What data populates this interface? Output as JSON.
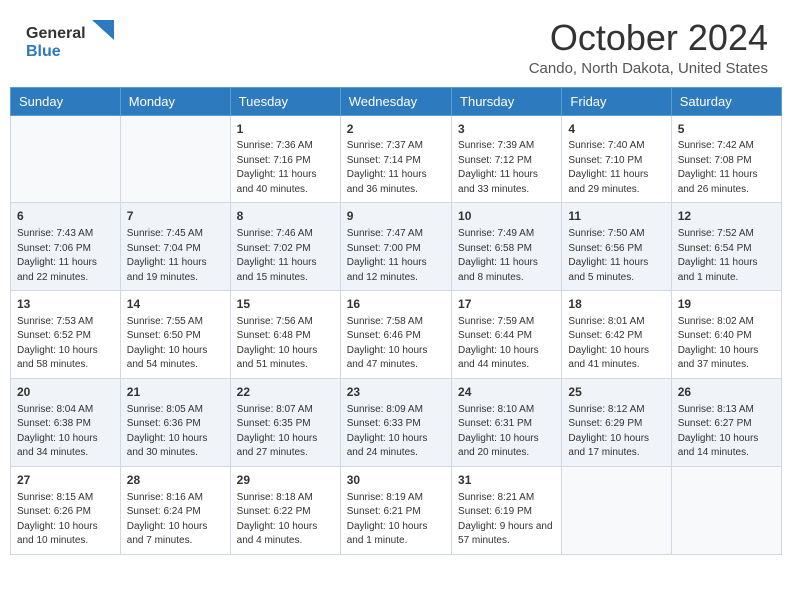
{
  "header": {
    "logo_line1": "General",
    "logo_line2": "Blue",
    "month": "October 2024",
    "location": "Cando, North Dakota, United States"
  },
  "days_of_week": [
    "Sunday",
    "Monday",
    "Tuesday",
    "Wednesday",
    "Thursday",
    "Friday",
    "Saturday"
  ],
  "weeks": [
    [
      {
        "day": "",
        "sunrise": "",
        "sunset": "",
        "daylight": ""
      },
      {
        "day": "",
        "sunrise": "",
        "sunset": "",
        "daylight": ""
      },
      {
        "day": "1",
        "sunrise": "Sunrise: 7:36 AM",
        "sunset": "Sunset: 7:16 PM",
        "daylight": "Daylight: 11 hours and 40 minutes."
      },
      {
        "day": "2",
        "sunrise": "Sunrise: 7:37 AM",
        "sunset": "Sunset: 7:14 PM",
        "daylight": "Daylight: 11 hours and 36 minutes."
      },
      {
        "day": "3",
        "sunrise": "Sunrise: 7:39 AM",
        "sunset": "Sunset: 7:12 PM",
        "daylight": "Daylight: 11 hours and 33 minutes."
      },
      {
        "day": "4",
        "sunrise": "Sunrise: 7:40 AM",
        "sunset": "Sunset: 7:10 PM",
        "daylight": "Daylight: 11 hours and 29 minutes."
      },
      {
        "day": "5",
        "sunrise": "Sunrise: 7:42 AM",
        "sunset": "Sunset: 7:08 PM",
        "daylight": "Daylight: 11 hours and 26 minutes."
      }
    ],
    [
      {
        "day": "6",
        "sunrise": "Sunrise: 7:43 AM",
        "sunset": "Sunset: 7:06 PM",
        "daylight": "Daylight: 11 hours and 22 minutes."
      },
      {
        "day": "7",
        "sunrise": "Sunrise: 7:45 AM",
        "sunset": "Sunset: 7:04 PM",
        "daylight": "Daylight: 11 hours and 19 minutes."
      },
      {
        "day": "8",
        "sunrise": "Sunrise: 7:46 AM",
        "sunset": "Sunset: 7:02 PM",
        "daylight": "Daylight: 11 hours and 15 minutes."
      },
      {
        "day": "9",
        "sunrise": "Sunrise: 7:47 AM",
        "sunset": "Sunset: 7:00 PM",
        "daylight": "Daylight: 11 hours and 12 minutes."
      },
      {
        "day": "10",
        "sunrise": "Sunrise: 7:49 AM",
        "sunset": "Sunset: 6:58 PM",
        "daylight": "Daylight: 11 hours and 8 minutes."
      },
      {
        "day": "11",
        "sunrise": "Sunrise: 7:50 AM",
        "sunset": "Sunset: 6:56 PM",
        "daylight": "Daylight: 11 hours and 5 minutes."
      },
      {
        "day": "12",
        "sunrise": "Sunrise: 7:52 AM",
        "sunset": "Sunset: 6:54 PM",
        "daylight": "Daylight: 11 hours and 1 minute."
      }
    ],
    [
      {
        "day": "13",
        "sunrise": "Sunrise: 7:53 AM",
        "sunset": "Sunset: 6:52 PM",
        "daylight": "Daylight: 10 hours and 58 minutes."
      },
      {
        "day": "14",
        "sunrise": "Sunrise: 7:55 AM",
        "sunset": "Sunset: 6:50 PM",
        "daylight": "Daylight: 10 hours and 54 minutes."
      },
      {
        "day": "15",
        "sunrise": "Sunrise: 7:56 AM",
        "sunset": "Sunset: 6:48 PM",
        "daylight": "Daylight: 10 hours and 51 minutes."
      },
      {
        "day": "16",
        "sunrise": "Sunrise: 7:58 AM",
        "sunset": "Sunset: 6:46 PM",
        "daylight": "Daylight: 10 hours and 47 minutes."
      },
      {
        "day": "17",
        "sunrise": "Sunrise: 7:59 AM",
        "sunset": "Sunset: 6:44 PM",
        "daylight": "Daylight: 10 hours and 44 minutes."
      },
      {
        "day": "18",
        "sunrise": "Sunrise: 8:01 AM",
        "sunset": "Sunset: 6:42 PM",
        "daylight": "Daylight: 10 hours and 41 minutes."
      },
      {
        "day": "19",
        "sunrise": "Sunrise: 8:02 AM",
        "sunset": "Sunset: 6:40 PM",
        "daylight": "Daylight: 10 hours and 37 minutes."
      }
    ],
    [
      {
        "day": "20",
        "sunrise": "Sunrise: 8:04 AM",
        "sunset": "Sunset: 6:38 PM",
        "daylight": "Daylight: 10 hours and 34 minutes."
      },
      {
        "day": "21",
        "sunrise": "Sunrise: 8:05 AM",
        "sunset": "Sunset: 6:36 PM",
        "daylight": "Daylight: 10 hours and 30 minutes."
      },
      {
        "day": "22",
        "sunrise": "Sunrise: 8:07 AM",
        "sunset": "Sunset: 6:35 PM",
        "daylight": "Daylight: 10 hours and 27 minutes."
      },
      {
        "day": "23",
        "sunrise": "Sunrise: 8:09 AM",
        "sunset": "Sunset: 6:33 PM",
        "daylight": "Daylight: 10 hours and 24 minutes."
      },
      {
        "day": "24",
        "sunrise": "Sunrise: 8:10 AM",
        "sunset": "Sunset: 6:31 PM",
        "daylight": "Daylight: 10 hours and 20 minutes."
      },
      {
        "day": "25",
        "sunrise": "Sunrise: 8:12 AM",
        "sunset": "Sunset: 6:29 PM",
        "daylight": "Daylight: 10 hours and 17 minutes."
      },
      {
        "day": "26",
        "sunrise": "Sunrise: 8:13 AM",
        "sunset": "Sunset: 6:27 PM",
        "daylight": "Daylight: 10 hours and 14 minutes."
      }
    ],
    [
      {
        "day": "27",
        "sunrise": "Sunrise: 8:15 AM",
        "sunset": "Sunset: 6:26 PM",
        "daylight": "Daylight: 10 hours and 10 minutes."
      },
      {
        "day": "28",
        "sunrise": "Sunrise: 8:16 AM",
        "sunset": "Sunset: 6:24 PM",
        "daylight": "Daylight: 10 hours and 7 minutes."
      },
      {
        "day": "29",
        "sunrise": "Sunrise: 8:18 AM",
        "sunset": "Sunset: 6:22 PM",
        "daylight": "Daylight: 10 hours and 4 minutes."
      },
      {
        "day": "30",
        "sunrise": "Sunrise: 8:19 AM",
        "sunset": "Sunset: 6:21 PM",
        "daylight": "Daylight: 10 hours and 1 minute."
      },
      {
        "day": "31",
        "sunrise": "Sunrise: 8:21 AM",
        "sunset": "Sunset: 6:19 PM",
        "daylight": "Daylight: 9 hours and 57 minutes."
      },
      {
        "day": "",
        "sunrise": "",
        "sunset": "",
        "daylight": ""
      },
      {
        "day": "",
        "sunrise": "",
        "sunset": "",
        "daylight": ""
      }
    ]
  ]
}
